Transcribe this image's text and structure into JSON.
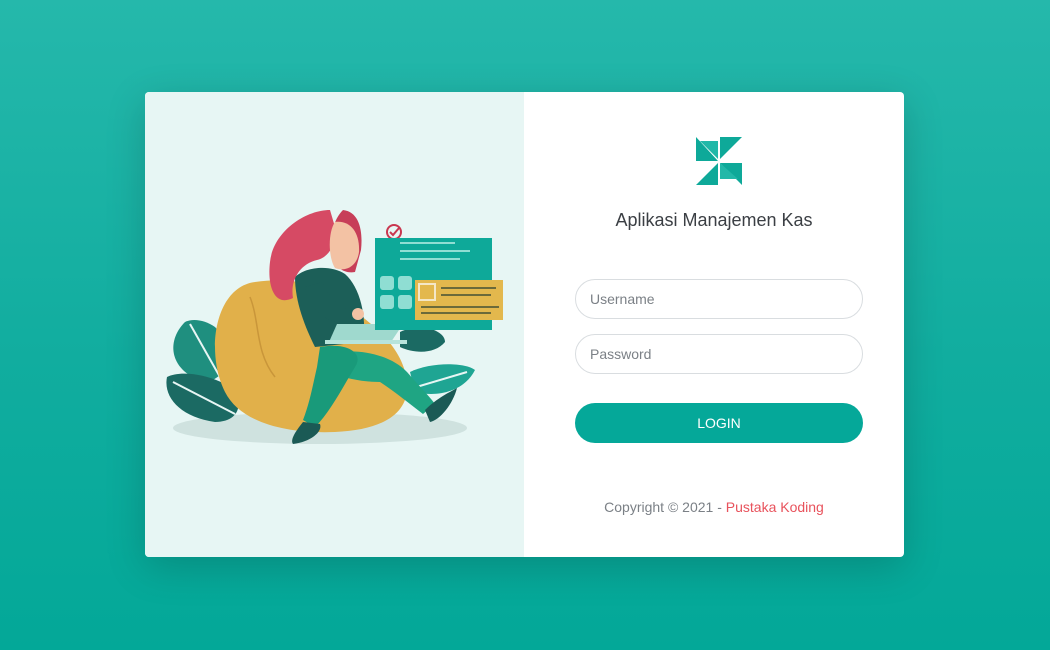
{
  "app": {
    "title": "Aplikasi Manajemen Kas"
  },
  "form": {
    "username_placeholder": "Username",
    "username_value": "",
    "password_placeholder": "Password",
    "password_value": "",
    "login_label": "LOGIN"
  },
  "footer": {
    "copyright_prefix": "Copyright © 2021 - ",
    "brand": "Pustaka Koding"
  },
  "icons": {
    "logo": "pinwheel-logo-icon",
    "illustration": "woman-on-beanbag-with-laptop-illustration"
  },
  "colors": {
    "primary": "#05a899",
    "background": "#13ae9f",
    "panel": "#e7f6f4",
    "accent_link": "#e8525c"
  }
}
